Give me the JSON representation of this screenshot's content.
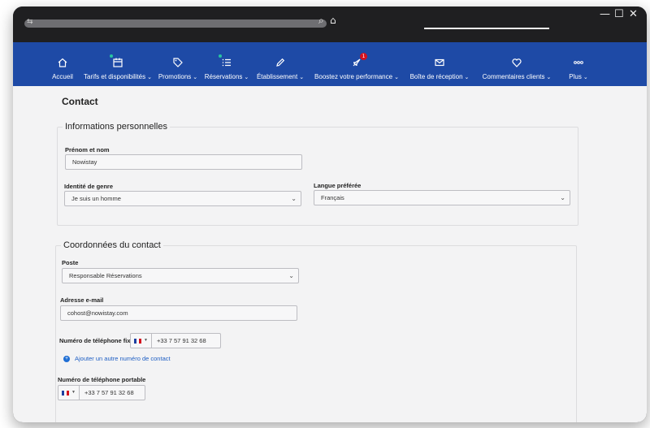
{
  "titlebar": {
    "url_icon": "⇆",
    "search_icon": "⌕",
    "home_icon": "⌂",
    "minimize_icon": "—",
    "maximize_icon": "☐",
    "close_icon": "✕"
  },
  "nav": {
    "items": [
      {
        "label": "Accueil",
        "icon": "home-icon",
        "caret": ""
      },
      {
        "label": "Tarifs et disponibilités",
        "icon": "calendar-icon",
        "caret": "⌄"
      },
      {
        "label": "Promotions",
        "icon": "tag-icon",
        "caret": "⌄"
      },
      {
        "label": "Réservations",
        "icon": "list-icon",
        "caret": "⌄"
      },
      {
        "label": "Établissement",
        "icon": "pencil-icon",
        "caret": "⌄"
      },
      {
        "label": "Boostez votre performance",
        "icon": "rocket-icon",
        "caret": "⌄",
        "badge": "1"
      },
      {
        "label": "Boîte de réception",
        "icon": "envelope-icon",
        "caret": "⌄"
      },
      {
        "label": "Commentaires clients",
        "icon": "heart-icon",
        "caret": "⌄"
      },
      {
        "label": "Plus",
        "icon": "more-icon",
        "caret": "⌄"
      }
    ]
  },
  "page": {
    "title": "Contact"
  },
  "personal": {
    "legend": "Informations personnelles",
    "name_label": "Prénom et nom",
    "name_value": "Nowistay",
    "gender_label": "Identité de genre",
    "gender_value": "Je suis un homme",
    "language_label": "Langue préférée",
    "language_value": "Français"
  },
  "contact": {
    "legend": "Coordonnées du contact",
    "position_label": "Poste",
    "position_value": "Responsable Réservations",
    "email_label": "Adresse e-mail",
    "email_value": "cohost@nowistay.com",
    "landline_label": "Numéro de téléphone fixe",
    "landline_value": "+33 7 57 91 32 68",
    "add_number_label": "Ajouter un autre numéro de contact",
    "mobile_label": "Numéro de téléphone portable",
    "mobile_value": "+33 7 57 91 32 68"
  },
  "colors": {
    "navbar": "#1e4aa6",
    "link": "#1f5fc4",
    "badge": "#d4111e",
    "window_frame": "#1f1f21"
  }
}
